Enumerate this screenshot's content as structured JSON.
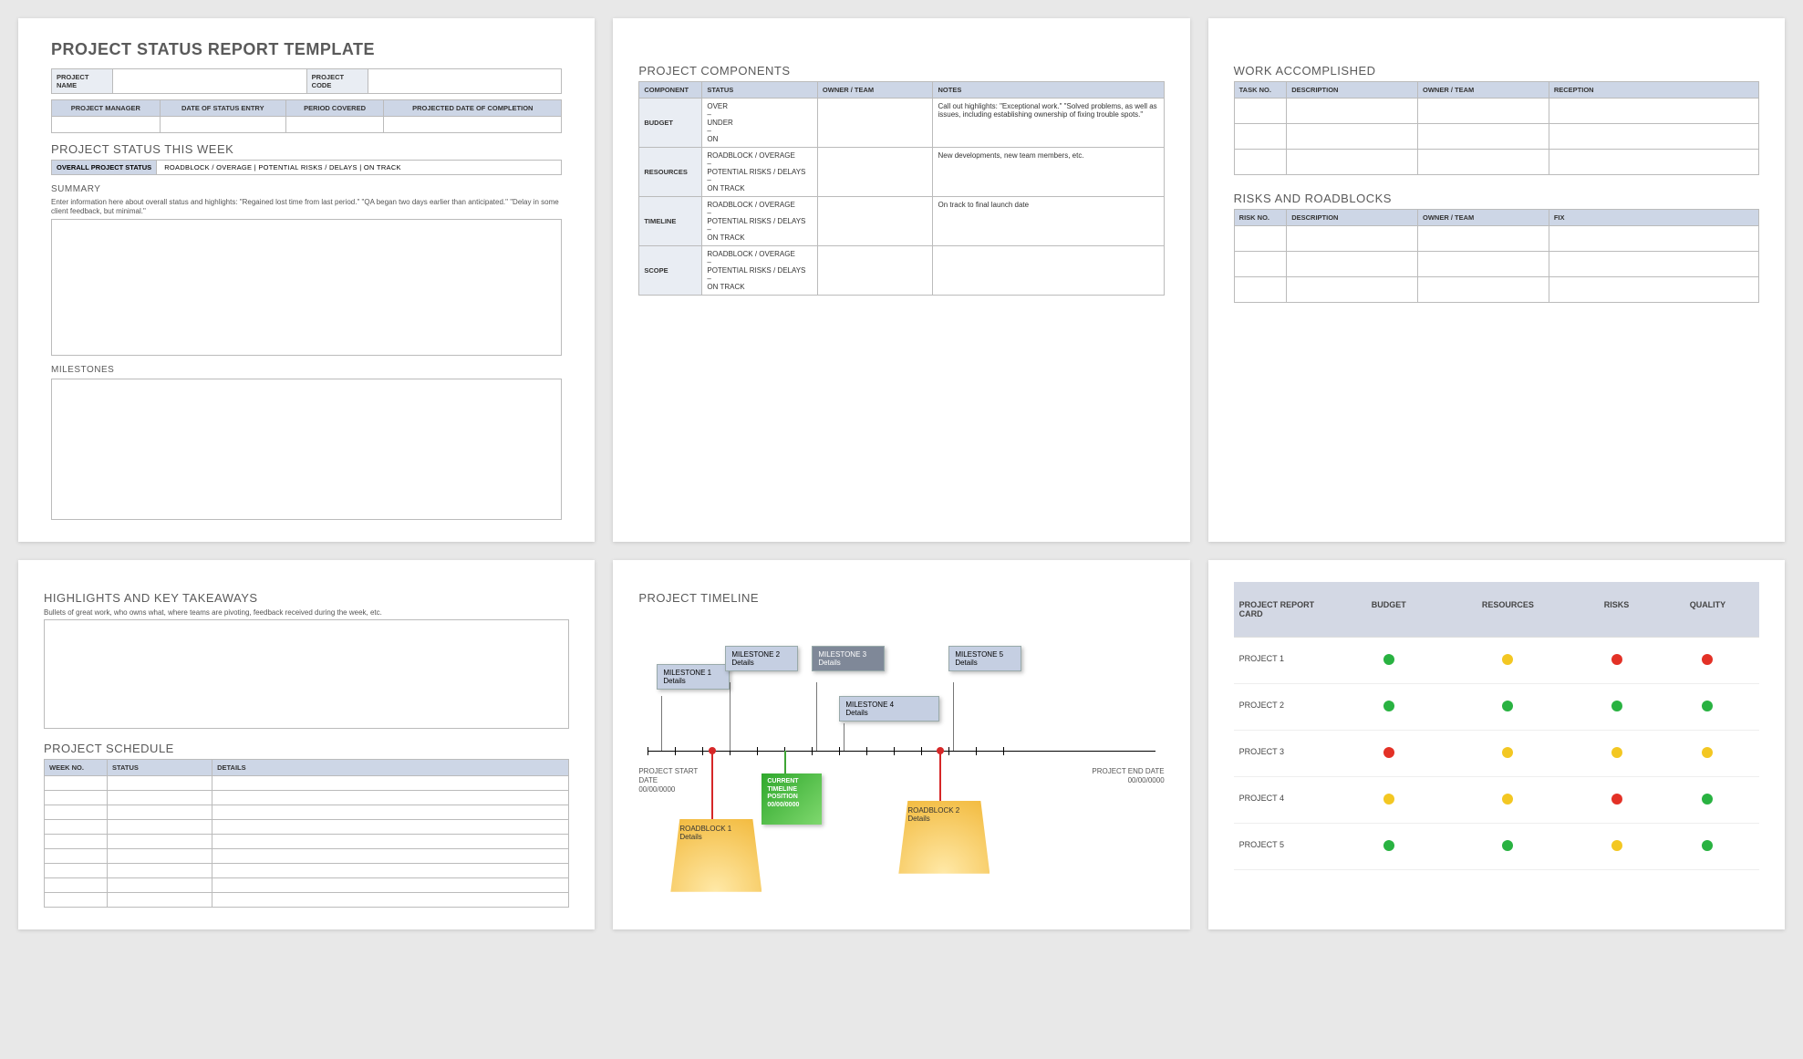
{
  "p1": {
    "title": "PROJECT STATUS REPORT TEMPLATE",
    "meta1": {
      "name_lbl": "PROJECT NAME",
      "code_lbl": "PROJECT CODE"
    },
    "meta2": {
      "h1": "PROJECT MANAGER",
      "h2": "DATE OF STATUS ENTRY",
      "h3": "PERIOD COVERED",
      "h4": "PROJECTED DATE OF COMPLETION"
    },
    "status_week_title": "PROJECT STATUS THIS WEEK",
    "overall_label": "OVERALL PROJECT STATUS",
    "overall_opts": "ROADBLOCK / OVERAGE   |   POTENTIAL RISKS / DELAYS   |   ON TRACK",
    "summary_title": "SUMMARY",
    "summary_hint": "Enter information here about overall status and highlights: \"Regained lost time from last period.\" \"QA began two days earlier than anticipated.\" \"Delay in some client feedback, but minimal.\"",
    "milestones_title": "MILESTONES"
  },
  "p2": {
    "title": "PROJECT COMPONENTS",
    "headers": {
      "c1": "COMPONENT",
      "c2": "STATUS",
      "c3": "OWNER / TEAM",
      "c4": "NOTES"
    },
    "rows": [
      {
        "label": "BUDGET",
        "status": "OVER\n–\nUNDER\n–\nON",
        "notes": "Call out highlights: \"Exceptional work.\" \"Solved problems, as well as issues, including establishing ownership of fixing trouble spots.\""
      },
      {
        "label": "RESOURCES",
        "status": "ROADBLOCK / OVERAGE\n–\nPOTENTIAL RISKS / DELAYS\n–\nON TRACK",
        "notes": "New developments, new team members, etc."
      },
      {
        "label": "TIMELINE",
        "status": "ROADBLOCK / OVERAGE\n–\nPOTENTIAL RISKS / DELAYS\n–\nON TRACK",
        "notes": "On track to final launch date"
      },
      {
        "label": "SCOPE",
        "status": "ROADBLOCK / OVERAGE\n–\nPOTENTIAL RISKS / DELAYS\n–\nON TRACK",
        "notes": ""
      }
    ]
  },
  "p3": {
    "work_title": "WORK ACCOMPLISHED",
    "work_headers": {
      "c1": "TASK NO.",
      "c2": "DESCRIPTION",
      "c3": "OWNER / TEAM",
      "c4": "RECEPTION"
    },
    "risks_title": "RISKS AND ROADBLOCKS",
    "risks_headers": {
      "c1": "RISK NO.",
      "c2": "DESCRIPTION",
      "c3": "OWNER / TEAM",
      "c4": "FIX"
    }
  },
  "p4": {
    "hl_title": "HIGHLIGHTS AND KEY TAKEAWAYS",
    "hl_hint": "Bullets of great work, who owns what, where teams are pivoting, feedback received during the week, etc.",
    "sched_title": "PROJECT SCHEDULE",
    "sched_headers": {
      "c1": "WEEK NO.",
      "c2": "STATUS",
      "c3": "DETAILS"
    }
  },
  "p5": {
    "title": "PROJECT TIMELINE",
    "start_lbl": "PROJECT START DATE",
    "start_date": "00/00/0000",
    "end_lbl": "PROJECT END DATE",
    "end_date": "00/00/0000",
    "m1_t": "MILESTONE 1",
    "m1_d": "Details",
    "m2_t": "MILESTONE 2",
    "m2_d": "Details",
    "m3_t": "MILESTONE 3",
    "m3_d": "Details",
    "m4_t": "MILESTONE 4",
    "m4_d": "Details",
    "m5_t": "MILESTONE 5",
    "m5_d": "Details",
    "rb1_t": "ROADBLOCK 1",
    "rb1_d": "Details",
    "rb2_t": "ROADBLOCK 2",
    "rb2_d": "Details",
    "cur_l1": "CURRENT",
    "cur_l2": "TIMELINE",
    "cur_l3": "POSITION",
    "cur_l4": "00/00/0000"
  },
  "p6": {
    "title": "PROJECT REPORT CARD",
    "headers": [
      "BUDGET",
      "RESOURCES",
      "RISKS",
      "QUALITY"
    ],
    "rows": [
      {
        "name": "PROJECT 1",
        "c": [
          "g",
          "y",
          "r",
          "r"
        ]
      },
      {
        "name": "PROJECT 2",
        "c": [
          "g",
          "g",
          "g",
          "g"
        ]
      },
      {
        "name": "PROJECT 3",
        "c": [
          "r",
          "y",
          "y",
          "y"
        ]
      },
      {
        "name": "PROJECT 4",
        "c": [
          "y",
          "y",
          "r",
          "g"
        ]
      },
      {
        "name": "PROJECT 5",
        "c": [
          "g",
          "g",
          "y",
          "g"
        ]
      }
    ]
  }
}
